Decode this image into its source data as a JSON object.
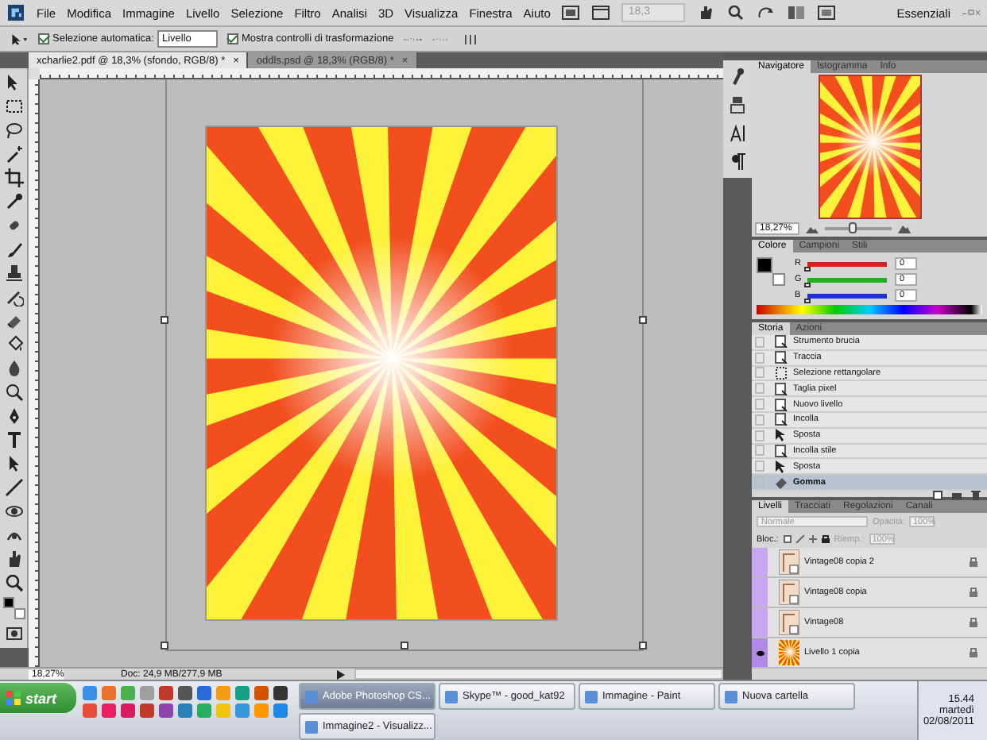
{
  "menu": {
    "items": [
      "File",
      "Modifica",
      "Immagine",
      "Livello",
      "Selezione",
      "Filtro",
      "Analisi",
      "3D",
      "Visualizza",
      "Finestra",
      "Aiuto"
    ],
    "zoom": "18,3",
    "workspace": "Essenziali"
  },
  "options": {
    "auto_select": {
      "label": "Selezione automatica:",
      "checked": true,
      "value": "Livello"
    },
    "transform_controls": {
      "label": "Mostra controlli di trasformazione",
      "checked": true
    }
  },
  "document_tabs": [
    {
      "label": "xcharlie2.pdf @ 18,3% (sfondo, RGB/8) *",
      "close": "×",
      "selected": true
    },
    {
      "label": "oddls.psd @ 18,3% (RGB/8) *",
      "close": "×",
      "selected": false
    }
  ],
  "status_bar": {
    "zoom": "18,27%",
    "doc_size": "Doc: 24,9 MB/277,9 MB"
  },
  "navigator": {
    "tabs": [
      {
        "label": "Navigatore",
        "selected": true
      },
      {
        "label": "Istogramma",
        "selected": false
      },
      {
        "label": "Info",
        "selected": false
      }
    ],
    "zoom": "18,27%",
    "level": 0.4
  },
  "color": {
    "tabs": [
      {
        "label": "Colore",
        "selected": true
      },
      {
        "label": "Campioni",
        "selected": false
      },
      {
        "label": "Stili",
        "selected": false
      }
    ],
    "channels": [
      {
        "label": "R",
        "value": "0",
        "level": 0,
        "color": "#d42020"
      },
      {
        "label": "G",
        "value": "0",
        "level": 0,
        "color": "#20b020"
      },
      {
        "label": "B",
        "value": "0",
        "level": 0,
        "color": "#2030d0"
      }
    ]
  },
  "history": {
    "tabs": [
      {
        "label": "Storia",
        "selected": true
      },
      {
        "label": "Azioni",
        "selected": false
      }
    ],
    "items": [
      {
        "label": "Strumento brucia",
        "kind": "doc",
        "selected": false
      },
      {
        "label": "Traccia",
        "kind": "doc",
        "selected": false
      },
      {
        "label": "Selezione rettangolare",
        "kind": "select",
        "selected": false
      },
      {
        "label": "Taglia pixel",
        "kind": "doc",
        "selected": false
      },
      {
        "label": "Nuovo livello",
        "kind": "doc",
        "selected": false
      },
      {
        "label": "Incolla",
        "kind": "doc",
        "selected": false
      },
      {
        "label": "Sposta",
        "kind": "move",
        "selected": false
      },
      {
        "label": "Incolla stile",
        "kind": "doc",
        "selected": false
      },
      {
        "label": "Sposta",
        "kind": "move",
        "selected": false
      },
      {
        "label": "Gomma",
        "kind": "eraser",
        "selected": true
      }
    ]
  },
  "layers": {
    "tabs": [
      {
        "label": "Livelli",
        "selected": true
      },
      {
        "label": "Tracciati",
        "selected": false
      },
      {
        "label": "Regolazioni",
        "selected": false
      },
      {
        "label": "Canali",
        "selected": false
      }
    ],
    "disabled": true,
    "blend_mode": "Normale",
    "opacity_label": "Opacità:",
    "opacity": "100%",
    "lock_label": "Bloc.:",
    "fill_label": "Riemp.:",
    "fill": "100%",
    "items": [
      {
        "name": "Vintage08 copia 2",
        "kind": "vintage",
        "visible": false
      },
      {
        "name": "Vintage08 copia",
        "kind": "vintage",
        "visible": false
      },
      {
        "name": "Vintage08",
        "kind": "vintage",
        "visible": false
      },
      {
        "name": "Livello 1 copia",
        "kind": "sunburst",
        "visible": true
      }
    ]
  },
  "taskbar": {
    "start": "start",
    "tasks": [
      {
        "label": "Adobe Photoshop CS...",
        "selected": true
      },
      {
        "label": "Skype™ - good_kat92",
        "selected": false
      },
      {
        "label": "Immagine - Paint",
        "selected": false
      },
      {
        "label": "Nuova cartella",
        "selected": false
      },
      {
        "label": "Immagine2 - Visualizz...",
        "selected": false
      }
    ],
    "clock": {
      "time": "15.44",
      "day": "martedì",
      "date": "02/08/2011"
    }
  }
}
